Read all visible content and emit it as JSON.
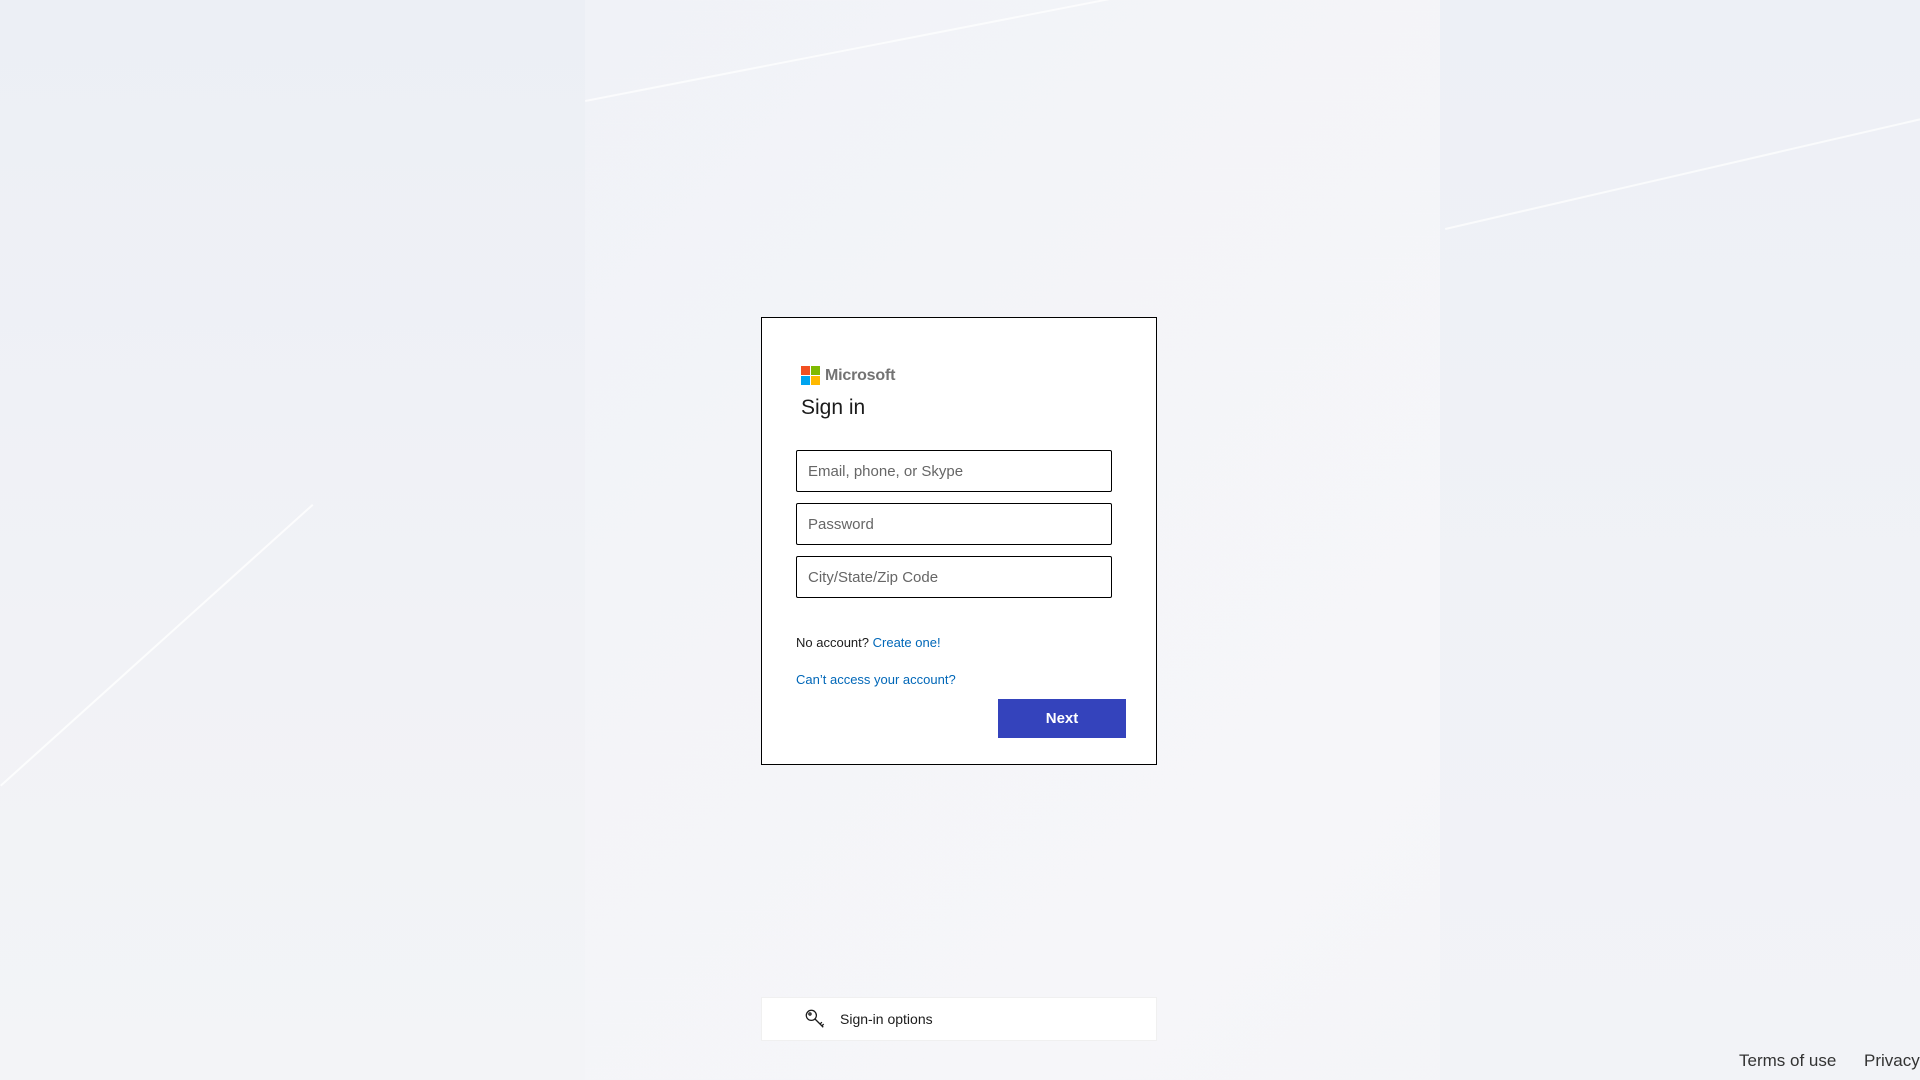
{
  "brand": {
    "name": "Microsoft",
    "logo_colors": [
      "#f25022",
      "#7fba00",
      "#00a4ef",
      "#ffb900"
    ]
  },
  "signin": {
    "title": "Sign in",
    "email_placeholder": "Email, phone, or Skype",
    "password_placeholder": "Password",
    "city_placeholder": "City/State/Zip Code",
    "no_account_text": "No account?",
    "create_link": "Create one!",
    "cant_access_link": "Can’t access your account?",
    "next_label": "Next"
  },
  "signin_options": {
    "label": "Sign-in options",
    "icon": "key-icon"
  },
  "footer": {
    "terms": "Terms of use",
    "privacy": "Privacy"
  },
  "colors": {
    "primary_button": "#3443bc",
    "link": "#0067b8"
  }
}
